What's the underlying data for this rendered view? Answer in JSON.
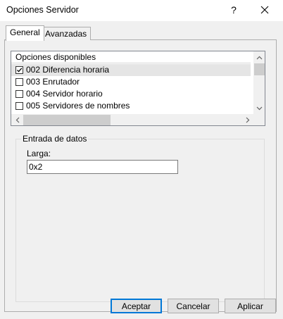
{
  "window": {
    "title": "Opciones Servidor",
    "help_label": "?"
  },
  "tabs": [
    {
      "label": "General",
      "active": true
    },
    {
      "label": "Avanzadas",
      "active": false
    }
  ],
  "options_list": {
    "header": "Opciones disponibles",
    "items": [
      {
        "label": "002 Diferencia horaria",
        "checked": true,
        "selected": true
      },
      {
        "label": "003 Enrutador",
        "checked": false,
        "selected": false
      },
      {
        "label": "004 Servidor horario",
        "checked": false,
        "selected": false
      },
      {
        "label": "005 Servidores de nombres",
        "checked": false,
        "selected": false
      }
    ]
  },
  "data_entry": {
    "group_label": "Entrada de datos",
    "field_label": "Larga:",
    "field_value": "0x2"
  },
  "buttons": {
    "accept": "Aceptar",
    "cancel": "Cancelar",
    "apply": "Aplicar"
  },
  "colors": {
    "default_button_border": "#0078d7",
    "selected_row": "#e5e5e5"
  }
}
